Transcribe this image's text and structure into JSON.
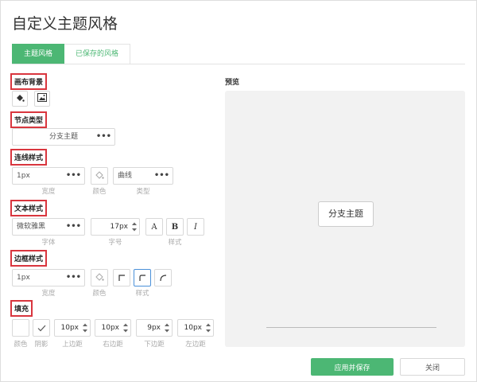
{
  "dialog": {
    "title": "自定义主题风格",
    "tabs": [
      {
        "label": "主题风格",
        "active": true
      },
      {
        "label": "已保存的风格",
        "active": false
      }
    ]
  },
  "sections": {
    "canvas_bg": {
      "label": "画布背景"
    },
    "node_type": {
      "label": "节点类型",
      "value": "分支主题"
    },
    "line_style": {
      "label": "连线样式",
      "width_value": "1px",
      "width_caption": "宽度",
      "color_caption": "颜色",
      "type_value": "曲线",
      "type_caption": "类型"
    },
    "text_style": {
      "label": "文本样式",
      "font_value": "微软雅黑",
      "font_caption": "字体",
      "size_value": "17px",
      "size_caption": "字号",
      "style_caption": "样式",
      "style_buttons": [
        "A",
        "B",
        "I"
      ]
    },
    "border_style": {
      "label": "边框样式",
      "width_value": "1px",
      "width_caption": "宽度",
      "color_caption": "颜色",
      "style_caption": "样式"
    },
    "fill": {
      "label": "填充",
      "color_caption": "颜色",
      "shadow_caption": "阴影",
      "top_value": "10px",
      "top_caption": "上边距",
      "right_value": "10px",
      "right_caption": "右边距",
      "bottom_value": "9px",
      "bottom_caption": "下边距",
      "left_value": "10px",
      "left_caption": "左边距"
    }
  },
  "preview": {
    "label": "预览",
    "node_text": "分支主题"
  },
  "footer": {
    "apply_label": "应用并保存",
    "close_label": "关闭"
  },
  "colors": {
    "accent": "#4cb774",
    "highlight": "#d9363e",
    "selected_border": "#4a90d9"
  }
}
